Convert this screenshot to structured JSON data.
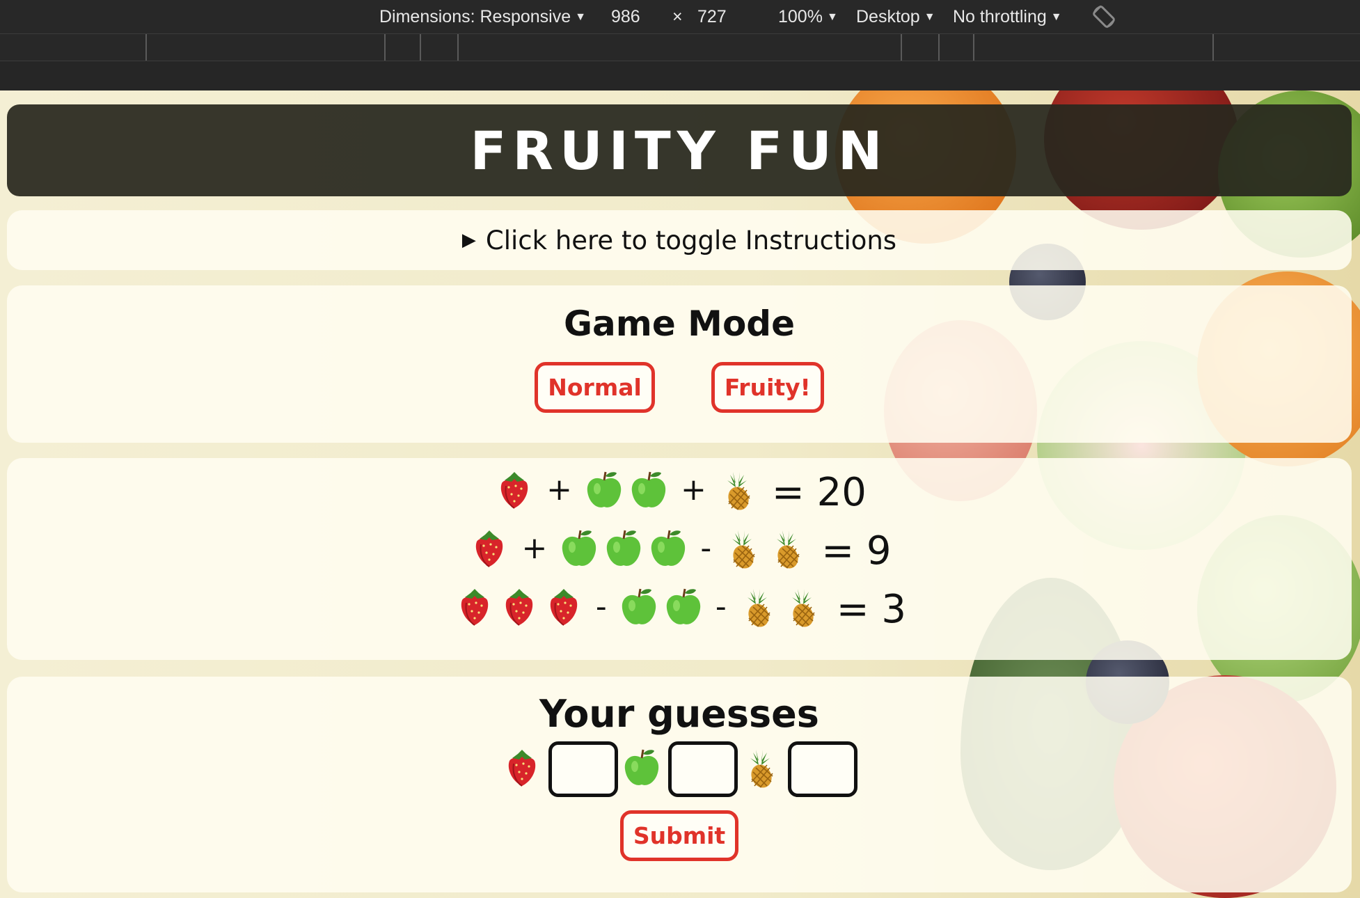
{
  "devtools": {
    "dimensions_label": "Dimensions: Responsive",
    "width": "986",
    "times": "×",
    "height": "727",
    "zoom": "100%",
    "device": "Desktop",
    "throttling": "No throttling"
  },
  "game": {
    "title": "FRUITY FUN",
    "instructions_toggle": "Click here to toggle Instructions",
    "mode_heading": "Game Mode",
    "mode_normal": "Normal",
    "mode_fruity": "Fruity!",
    "equations": [
      {
        "terms": [
          [
            "strawberry"
          ],
          "+",
          [
            "apple",
            "apple"
          ],
          "+",
          [
            "pineapple"
          ]
        ],
        "result": "= 20"
      },
      {
        "terms": [
          [
            "strawberry"
          ],
          "+",
          [
            "apple",
            "apple",
            "apple"
          ],
          "-",
          [
            "pineapple",
            "pineapple"
          ]
        ],
        "result": "= 9"
      },
      {
        "terms": [
          [
            "strawberry",
            "strawberry",
            "strawberry"
          ],
          "-",
          [
            "apple",
            "apple"
          ],
          "-",
          [
            "pineapple",
            "pineapple"
          ]
        ],
        "result": "= 3"
      }
    ],
    "guesses_heading": "Your guesses",
    "guess_fruits": [
      "strawberry",
      "apple",
      "pineapple"
    ],
    "submit": "Submit"
  },
  "colors": {
    "accent": "#e0332a",
    "title_bar": "#2a2a20",
    "panel": "#fffdf0"
  }
}
